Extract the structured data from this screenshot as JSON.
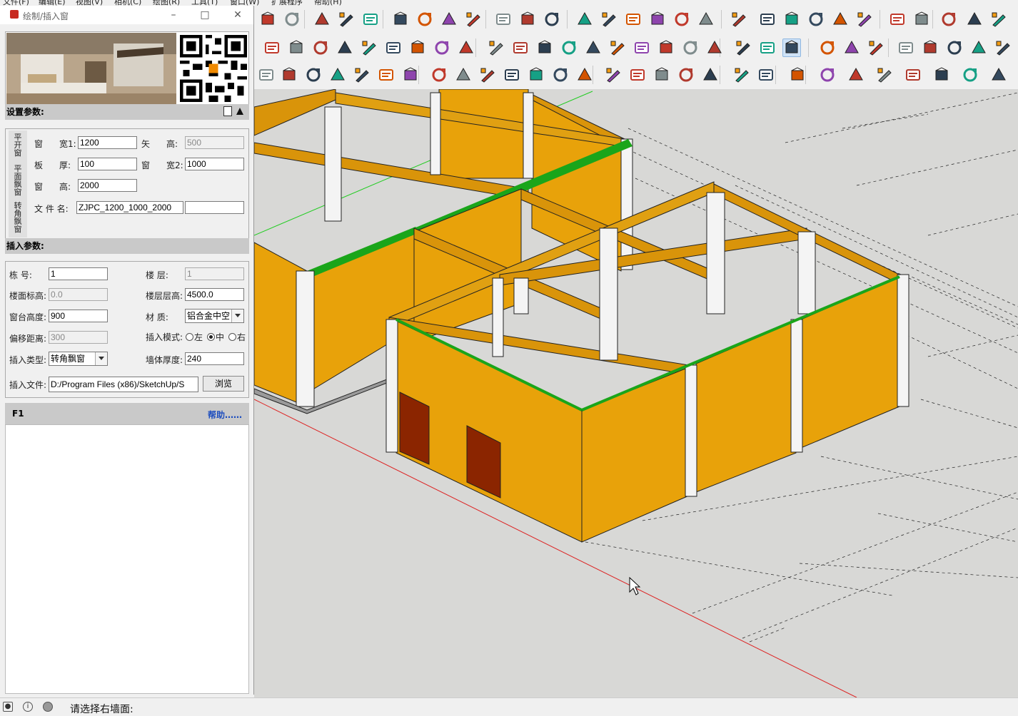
{
  "menubar": [
    "文件(F)",
    "编辑(E)",
    "视图(V)",
    "相机(C)",
    "绘图(R)",
    "工具(T)",
    "窗口(W)",
    "扩展程序",
    "帮助(H)"
  ],
  "panel": {
    "title": "绘制/插入窗",
    "settings_header": "设置参数:",
    "vertical_tabs": [
      "平开窗",
      "平面飘窗",
      "转角飘窗"
    ],
    "settings": {
      "window_width1_label_a": "窗",
      "window_width1_label_b": "宽1:",
      "window_width1_value": "1200",
      "vector_height_label_a": "矢",
      "vector_height_label_b": "高:",
      "vector_height_value": "500",
      "board_thickness_label_a": "板",
      "board_thickness_label_b": "厚:",
      "board_thickness_value": "100",
      "window_width2_label_a": "窗",
      "window_width2_label_b": "宽2:",
      "window_width2_value": "1000",
      "window_height_label_a": "窗",
      "window_height_label_b": "高:",
      "window_height_value": "2000",
      "filename_label": "文 件 名:",
      "filename_value": "ZJPC_1200_1000_2000",
      "filename_extra_value": ""
    },
    "insert_header": "插入参数:",
    "insert": {
      "building_label": "栋      号:",
      "building_value": "1",
      "floor_label": "楼      层:",
      "floor_value": "1",
      "floor_elev_label": "楼面标高:",
      "floor_elev_value": "0.0",
      "floor_height_label": "楼层层高:",
      "floor_height_value": "4500.0",
      "sill_height_label": "窗台高度:",
      "sill_height_value": "900",
      "material_label": "材      质:",
      "material_value": "铝合金中空",
      "offset_label": "偏移距离:",
      "offset_value": "300",
      "mode_label": "插入模式:",
      "mode_options": [
        "左",
        "中",
        "右"
      ],
      "mode_selected": "中",
      "type_label": "插入类型:",
      "type_value": "转角飘窗",
      "wall_thickness_label": "墙体厚度:",
      "wall_thickness_value": "240",
      "file_label": "插入文件:",
      "file_value": "D:/Program Files (x86)/SketchUp/S",
      "browse_label": "浏览"
    },
    "help_key": "F1",
    "help_link": "帮助……"
  },
  "statusbar": {
    "message": "请选择右墙面:"
  },
  "colors": {
    "wall": "#e8a20a",
    "wall_dark": "#c78b06",
    "beam": "#d9940a",
    "column": "#f2f2f2",
    "selected_edge": "#1aa51a",
    "door": "#8b2500",
    "viewport_bg": "#d8d8d6",
    "help_link": "#1f4fbf"
  },
  "toolbar_icons": [
    "refresh-icon",
    "component-icon",
    "tape-icon",
    "text-icon",
    "paint-bucket-icon",
    "orbit-icon",
    "pan-icon",
    "zoom-icon",
    "zoom-extents-icon",
    "warehouse-icon",
    "ext-warehouse-icon",
    "send-layout-icon",
    "iso-view-icon",
    "top-view-icon",
    "front-view-icon",
    "right-view-icon",
    "back-view-icon",
    "left-view-icon",
    "xray-icon",
    "back-edges-icon",
    "wireframe-icon",
    "hidden-line-icon",
    "shaded-icon",
    "texture-icon",
    "section-plane-icon",
    "section-fill-icon",
    "follow-me-icon",
    "style-icon"
  ]
}
